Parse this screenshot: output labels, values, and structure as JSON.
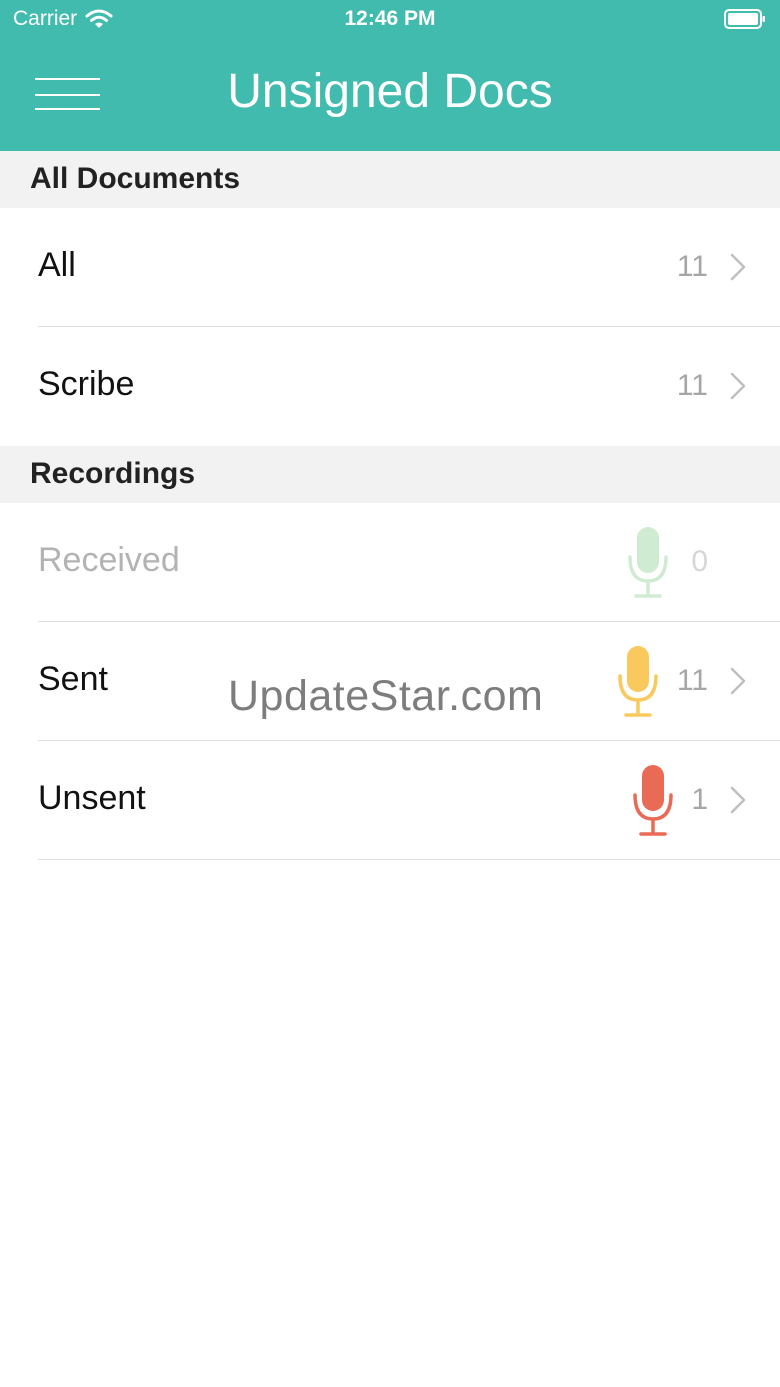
{
  "status_bar": {
    "carrier": "Carrier",
    "time": "12:46 PM"
  },
  "header": {
    "title": "Unsigned Docs",
    "menu_icon": "hamburger-menu-icon"
  },
  "sections": [
    {
      "title": "All Documents",
      "items": [
        {
          "label": "All",
          "count": "11"
        },
        {
          "label": "Scribe",
          "count": "11"
        }
      ]
    },
    {
      "title": "Recordings",
      "items": [
        {
          "label": "Received",
          "count": "0",
          "icon": "microphone-icon",
          "color": "#cfecd3",
          "enabled": false
        },
        {
          "label": "Sent",
          "count": "11",
          "icon": "microphone-icon",
          "color": "#f9c95d",
          "enabled": true
        },
        {
          "label": "Unsent",
          "count": "1",
          "icon": "microphone-icon",
          "color": "#e96a55",
          "enabled": true
        }
      ]
    }
  ],
  "watermark": "UpdateStar.com",
  "colors": {
    "header": "#40bbad",
    "section_background": "#f2f2f2"
  }
}
